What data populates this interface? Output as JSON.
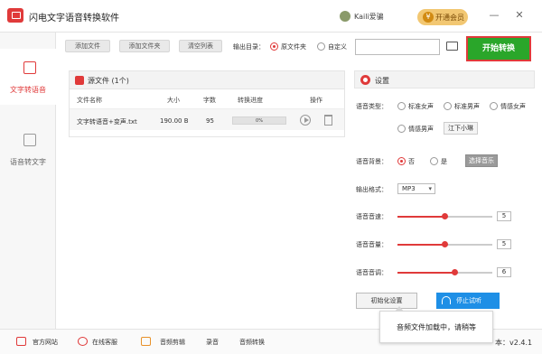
{
  "titlebar": {
    "title": "闪电文字语音转换软件",
    "user_name": "Kaili爱骗",
    "vip_label": "开通会员",
    "vip_icon": "¥",
    "minimize": "—",
    "close": "✕"
  },
  "sidebar": {
    "items": [
      {
        "label": "文字转语音",
        "icon": "text-to-speech-icon",
        "active": true
      },
      {
        "label": "语音转文字",
        "icon": "speech-to-text-icon",
        "active": false
      }
    ]
  },
  "toolbar": {
    "add_file": "添加文件",
    "add_folder": "添加文件夹",
    "clear_list": "清空列表",
    "output_dir_label": "输出目录：",
    "output_options": [
      "原文件夹",
      "自定义"
    ],
    "output_selected": "原文件夹",
    "path_value": "",
    "start_button": "开始转换"
  },
  "file_panel": {
    "title": "源文件 (1个)",
    "columns": [
      "文件名称",
      "大小",
      "字数",
      "转换进度",
      "操作"
    ],
    "rows": [
      {
        "name": "文字转语音+变声.txt",
        "size": "190.00 B",
        "words": "95",
        "progress": "0%",
        "progress_value": 0
      }
    ]
  },
  "settings": {
    "title": "设置",
    "voice_type_label": "语音类型：",
    "voice_types": [
      "标准女声",
      "标准男声",
      "情感女声",
      "情感男声"
    ],
    "voice_type_selected": "",
    "voice_preset_button": "江下小琳",
    "background_label": "语音背景：",
    "background_options": [
      "否",
      "是"
    ],
    "background_selected": "否",
    "choose_music_button": "选择音乐",
    "format_label": "输出格式：",
    "format_value": "MP3",
    "speed_label": "语音音速：",
    "speed_value": "5",
    "speed_max": 10,
    "volume_label": "语音音量：",
    "volume_value": "5",
    "volume_max": 10,
    "pitch_label": "语音音调：",
    "pitch_value": "6",
    "pitch_max": 10,
    "init_button": "初始化设置",
    "stop_button": "停止试听"
  },
  "tooltip": {
    "text": "音频文件加载中，请稍等"
  },
  "bottombar": {
    "official_site": "官方网站",
    "online_service": "在线客服",
    "audio_edit": "音频剪辑",
    "record": "录音",
    "audio_convert": "音频转换",
    "version": "本：v2.4.1"
  },
  "colors": {
    "accent": "#e03a3a",
    "start_button": "#2aa62a",
    "stop_button": "#1e8fe6",
    "vip": "#f2c772"
  }
}
